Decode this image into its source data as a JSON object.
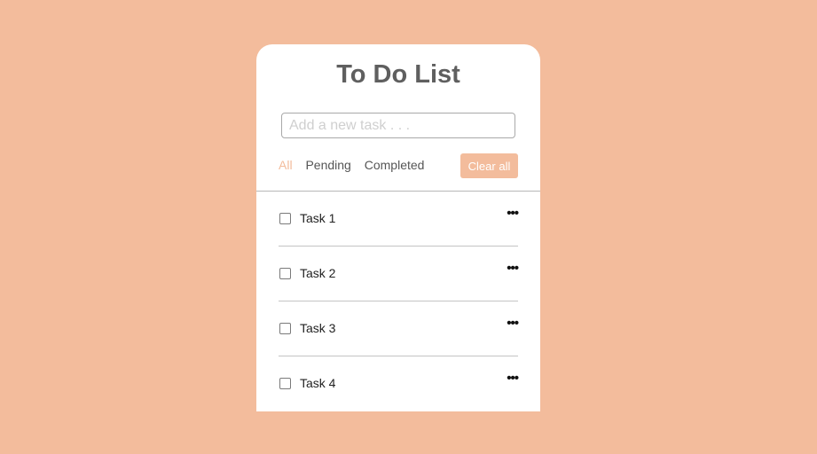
{
  "app": {
    "title": "To Do List"
  },
  "input": {
    "placeholder": "Add a new task . . .",
    "value": ""
  },
  "filters": [
    {
      "label": "All",
      "active": true
    },
    {
      "label": "Pending",
      "active": false
    },
    {
      "label": "Completed",
      "active": false
    }
  ],
  "clear_button": {
    "label": "Clear all"
  },
  "tasks": [
    {
      "label": "Task 1",
      "checked": false,
      "menu_icon": "ellipsis-icon"
    },
    {
      "label": "Task 2",
      "checked": false,
      "menu_icon": "ellipsis-icon"
    },
    {
      "label": "Task 3",
      "checked": false,
      "menu_icon": "ellipsis-icon"
    },
    {
      "label": "Task 4",
      "checked": false,
      "menu_icon": "ellipsis-icon"
    }
  ],
  "colors": {
    "background": "#f3bc9c",
    "accent": "#f3bc9c",
    "card": "#ffffff",
    "title": "#5f5f5f"
  }
}
